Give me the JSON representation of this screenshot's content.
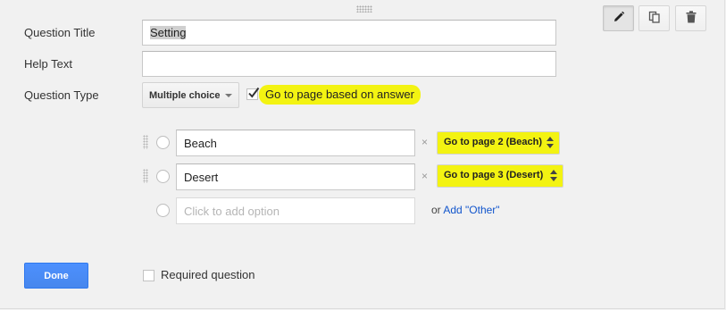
{
  "toolbar": {
    "edit_icon": "pencil-icon",
    "duplicate_icon": "duplicate-icon",
    "delete_icon": "trash-icon"
  },
  "form": {
    "question_title_label": "Question Title",
    "question_title_value": "Setting",
    "help_text_label": "Help Text",
    "help_text_value": "",
    "question_type_label": "Question Type",
    "question_type_value": "Multiple choice",
    "go_to_page_label": "Go to page based on answer",
    "go_to_page_checked": true
  },
  "options": [
    {
      "label": "Beach",
      "remove": "×",
      "page": "Go to page 2 (Beach)"
    },
    {
      "label": "Desert",
      "remove": "×",
      "page": "Go to page 3 (Desert)"
    }
  ],
  "add_option": {
    "placeholder": "Click to add option",
    "or_text": "or",
    "add_other_link": "Add \"Other\""
  },
  "footer": {
    "done_label": "Done",
    "required_label": "Required question",
    "required_checked": false
  },
  "colors": {
    "highlight": "#f3f312",
    "done_button": "#4d90fe",
    "link": "#1155cc"
  }
}
